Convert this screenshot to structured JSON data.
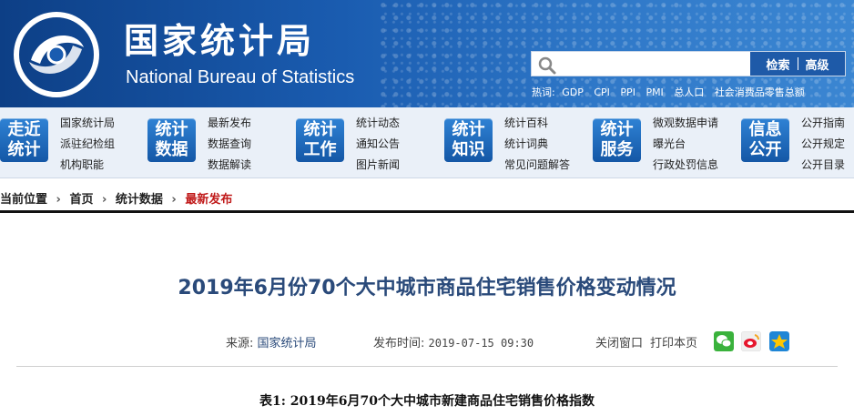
{
  "header": {
    "title_cn": "国家统计局",
    "title_en": "National Bureau of Statistics",
    "search_placeholder": "",
    "search_button": "检索",
    "advanced_button": "高级",
    "hotwords_label": "热词:",
    "hotwords": [
      "GDP",
      "CPI",
      "PPI",
      "PMI",
      "总人口",
      "社会消费品零售总额"
    ]
  },
  "nav": [
    {
      "tile": "走近统计",
      "links": [
        "国家统计局",
        "派驻纪检组",
        "机构职能"
      ]
    },
    {
      "tile": "统计数据",
      "links": [
        "最新发布",
        "数据查询",
        "数据解读"
      ]
    },
    {
      "tile": "统计工作",
      "links": [
        "统计动态",
        "通知公告",
        "图片新闻"
      ]
    },
    {
      "tile": "统计知识",
      "links": [
        "统计百科",
        "统计词典",
        "常见问题解答"
      ]
    },
    {
      "tile": "统计服务",
      "links": [
        "微观数据申请",
        "曝光台",
        "行政处罚信息"
      ]
    },
    {
      "tile": "信息公开",
      "links": [
        "公开指南",
        "公开规定",
        "公开目录"
      ]
    }
  ],
  "breadcrumb": {
    "prefix": "当前位置",
    "items": [
      "首页",
      "统计数据"
    ],
    "current": "最新发布"
  },
  "article": {
    "title": "2019年6月份70个大中城市商品住宅销售价格变动情况",
    "source_label": "来源:",
    "source": "国家统计局",
    "time_label": "发布时间:",
    "time": "2019-07-15 09:30",
    "close_window": "关闭窗口",
    "print_page": "打印本页",
    "table_caption": "表1:  2019年6月70个大中城市新建商品住宅销售价格指数"
  },
  "colors": {
    "header_blue": "#1a5cb0",
    "title_blue": "#2a4a7a",
    "current_red": "#c01a1a"
  }
}
